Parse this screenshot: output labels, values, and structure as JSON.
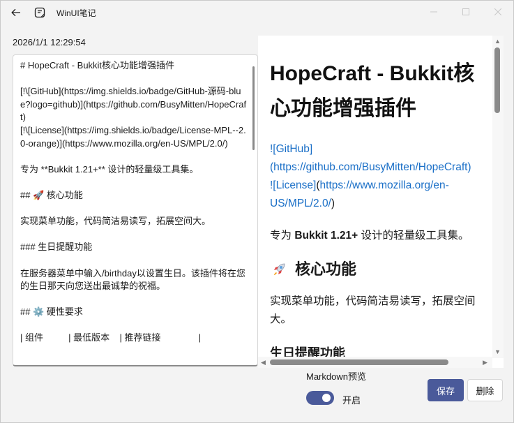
{
  "window": {
    "title": "WinUI笔记",
    "controls": {
      "minimize": "—",
      "maximize": "□",
      "close": "✕"
    }
  },
  "note": {
    "timestamp": "2026/1/1 12:29:54",
    "editor_lines": [
      "# HopeCraft - Bukkit核心功能增强插件",
      "",
      "[!\\[GitHub](https://img.shields.io/badge/GitHub-源码-blue?logo=github)](https://github.com/BusyMitten/HopeCraft)",
      "[!\\[License](https://img.shields.io/badge/License-MPL--2.0-orange)](https://www.mozilla.org/en-US/MPL/2.0/)",
      "",
      "专为 **Bukkit 1.21+** 设计的轻量级工具集。",
      "",
      "## 🚀 核心功能",
      "",
      "实现菜单功能，代码简洁易读写，拓展空间大。",
      "",
      "### 生日提醒功能",
      "",
      "在服务器菜单中输入/birthday以设置生日。该插件将在您的生日那天向您送出最诚挚的祝福。",
      "",
      "## ⚙️ 硬性要求",
      "",
      "| 组件          | 最低版本    | 推荐链接               |"
    ]
  },
  "preview": {
    "h1": "HopeCraft - Bukkit核心功能增强插件",
    "badges": {
      "github_text": "![GitHub]",
      "github_url": "(https://github.com/BusyMitten/HopeCraft)",
      "license_text": "![License]",
      "license_url_open": "(",
      "license_url": "https://www.mozilla.org/en-US/MPL/2.0/",
      "license_url_close": ")"
    },
    "intro_prefix": "专为 ",
    "intro_bold": "Bukkit 1.21+",
    "intro_suffix": " 设计的轻量级工具集。",
    "h2_core": "核心功能",
    "core_text": "实现菜单功能，代码简洁易读写，拓展空间大。",
    "h3_birthday": "生日提醒功能"
  },
  "controls": {
    "toggle_label": "Markdown预览",
    "toggle_state": "开启",
    "toggle_on": true,
    "save_label": "保存",
    "delete_label": "删除"
  },
  "colors": {
    "accent": "#4a5a9a",
    "link": "#1a6fc7"
  }
}
